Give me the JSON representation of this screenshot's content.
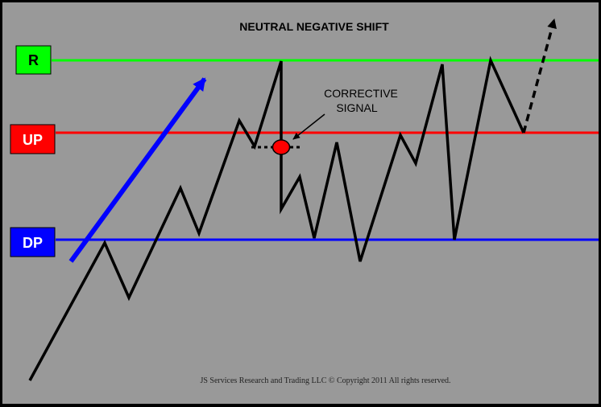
{
  "title": "NEUTRAL NEGATIVE SHIFT",
  "annotation": {
    "line1": "CORRECTIVE",
    "line2": "SIGNAL"
  },
  "levels": [
    {
      "id": "r",
      "label": "R",
      "color": "#00ff00"
    },
    {
      "id": "up",
      "label": "UP",
      "color": "#ff0000"
    },
    {
      "id": "dp",
      "label": "DP",
      "color": "#0000ff"
    }
  ],
  "footer": "JS Services Research and Trading LLC © Copyright 2011 All rights reserved.",
  "colors": {
    "background": "#999999",
    "frame": "#000000",
    "price_line": "#000000",
    "trend_arrow": "#0000ff",
    "signal_dot": "#ff0000",
    "r_label_text": "#000000",
    "up_label_text": "#ffffff",
    "dp_label_text": "#ffffff"
  }
}
